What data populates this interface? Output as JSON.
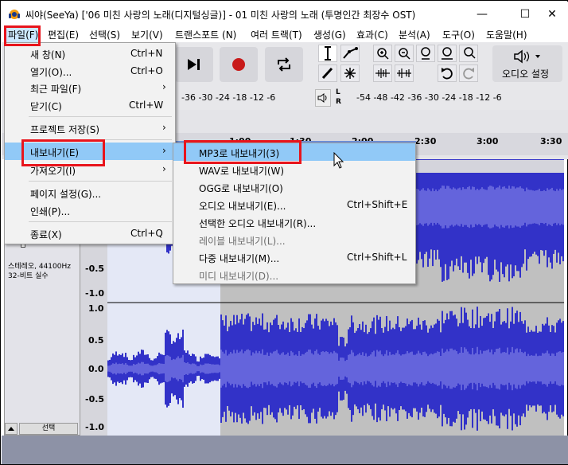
{
  "window": {
    "title": "씨야(SeeYa) ['06 미친 사랑의 노래(디지털싱글)] - 01 미친 사랑의 노래 (투명인간 최장수 OST)",
    "minimize": "—",
    "maximize": "☐",
    "close": "✕"
  },
  "menubar": [
    {
      "label": "파일(F)"
    },
    {
      "label": "편집(E)"
    },
    {
      "label": "선택(S)"
    },
    {
      "label": "보기(V)"
    },
    {
      "label": "트랜스포트 (N)"
    },
    {
      "label": "여러 트랙(T)"
    },
    {
      "label": "생성(G)"
    },
    {
      "label": "효과(C)"
    },
    {
      "label": "분석(A)"
    },
    {
      "label": "도구(O)"
    },
    {
      "label": "도움말(H)"
    }
  ],
  "file_menu": [
    {
      "label": "새 창(N)",
      "shortcut": "Ctrl+N"
    },
    {
      "label": "열기(O)...",
      "shortcut": "Ctrl+O"
    },
    {
      "label": "최근 파일(F)",
      "arrow": "›"
    },
    {
      "label": "닫기(C)",
      "shortcut": "Ctrl+W"
    },
    {
      "label": "프로젝트 저장(S)",
      "arrow": "›"
    },
    {
      "label": "내보내기(E)",
      "arrow": "›"
    },
    {
      "label": "가져오기(I)",
      "arrow": "›"
    },
    {
      "label": "페이지 설정(G)..."
    },
    {
      "label": "인쇄(P)..."
    },
    {
      "label": "종료(X)",
      "shortcut": "Ctrl+Q"
    }
  ],
  "export_menu": [
    {
      "label": "MP3로 내보내기(3)"
    },
    {
      "label": "WAV로 내보내기(W)"
    },
    {
      "label": "OGG로 내보내기(O)"
    },
    {
      "label": "오디오 내보내기(E)...",
      "shortcut": "Ctrl+Shift+E"
    },
    {
      "label": "선택한 오디오 내보내기(R)..."
    },
    {
      "label": "레이블 내보내기(L)..."
    },
    {
      "label": "다중 내보내기(M)...",
      "shortcut": "Ctrl+Shift+L"
    },
    {
      "label": "미디 내보내기(D)..."
    }
  ],
  "toolbar": {
    "audio_setup": "오디오 설정"
  },
  "meter": {
    "left_scale": "-36 -30 -24 -18 -12 -6",
    "right_scale": "-54 -48 -42 -36 -30 -24 -18 -12 -6",
    "l": "L",
    "r": "R"
  },
  "ruler": [
    "1:00",
    "1:30",
    "2:00",
    "2:30",
    "3:00",
    "3:30"
  ],
  "track": {
    "clip_title": "래 (투명인간 최장수 OST)",
    "info_line1": "스테레오, 44100Hz",
    "info_line2": "32-비트 실수",
    "select_label": "선택",
    "scale_labels": [
      "-0.5",
      "-1.0",
      "1.0",
      "0.5",
      "0.0",
      "-0.5",
      "-1.0"
    ]
  },
  "colors": {
    "highlight_box": "#e8141c",
    "menu_highlight": "#91c9f7",
    "waveform": "#3232c8",
    "waveform_light": "#6464dc"
  }
}
